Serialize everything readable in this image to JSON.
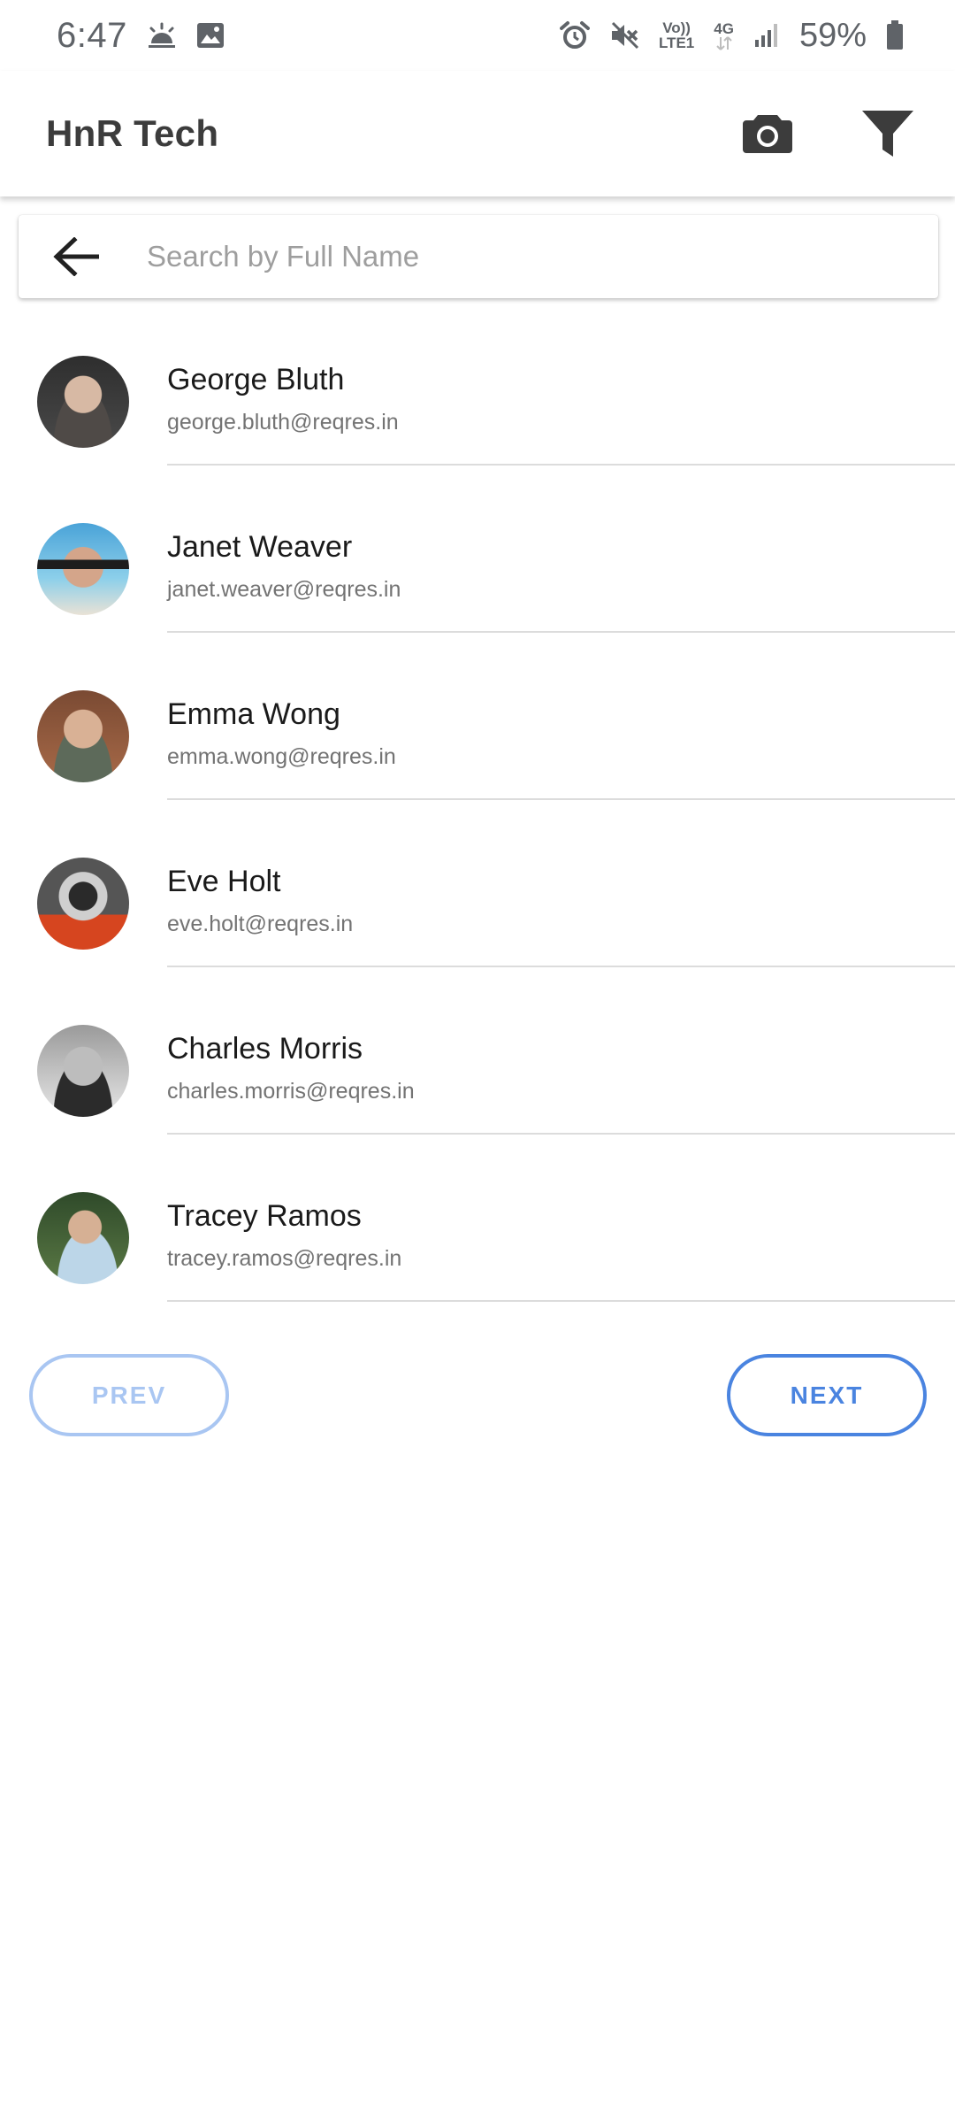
{
  "status_bar": {
    "time": "6:47",
    "battery_percent": "59%",
    "volte_top": "Vo))",
    "volte_bottom": "LTE1",
    "network": "4G",
    "icons": [
      "weather-icon",
      "gallery-icon",
      "alarm-icon",
      "mute-icon",
      "volte-icon",
      "network-4g-icon",
      "signal-icon",
      "battery-icon"
    ]
  },
  "app_bar": {
    "title": "HnR Tech",
    "actions": [
      "camera-icon",
      "filter-icon"
    ]
  },
  "search": {
    "placeholder": "Search by Full Name",
    "value": ""
  },
  "users": [
    {
      "name": "George Bluth",
      "email": "george.bluth@reqres.in"
    },
    {
      "name": "Janet Weaver",
      "email": "janet.weaver@reqres.in"
    },
    {
      "name": "Emma Wong",
      "email": "emma.wong@reqres.in"
    },
    {
      "name": "Eve Holt",
      "email": "eve.holt@reqres.in"
    },
    {
      "name": "Charles Morris",
      "email": "charles.morris@reqres.in"
    },
    {
      "name": "Tracey Ramos",
      "email": "tracey.ramos@reqres.in"
    }
  ],
  "pagination": {
    "prev_label": "PREV",
    "next_label": "NEXT",
    "prev_enabled": false,
    "next_enabled": true
  },
  "colors": {
    "accent": "#4a84e0",
    "accent_disabled": "#a9c6f2",
    "secondary_text": "#737373",
    "divider": "#dcdcdc"
  }
}
